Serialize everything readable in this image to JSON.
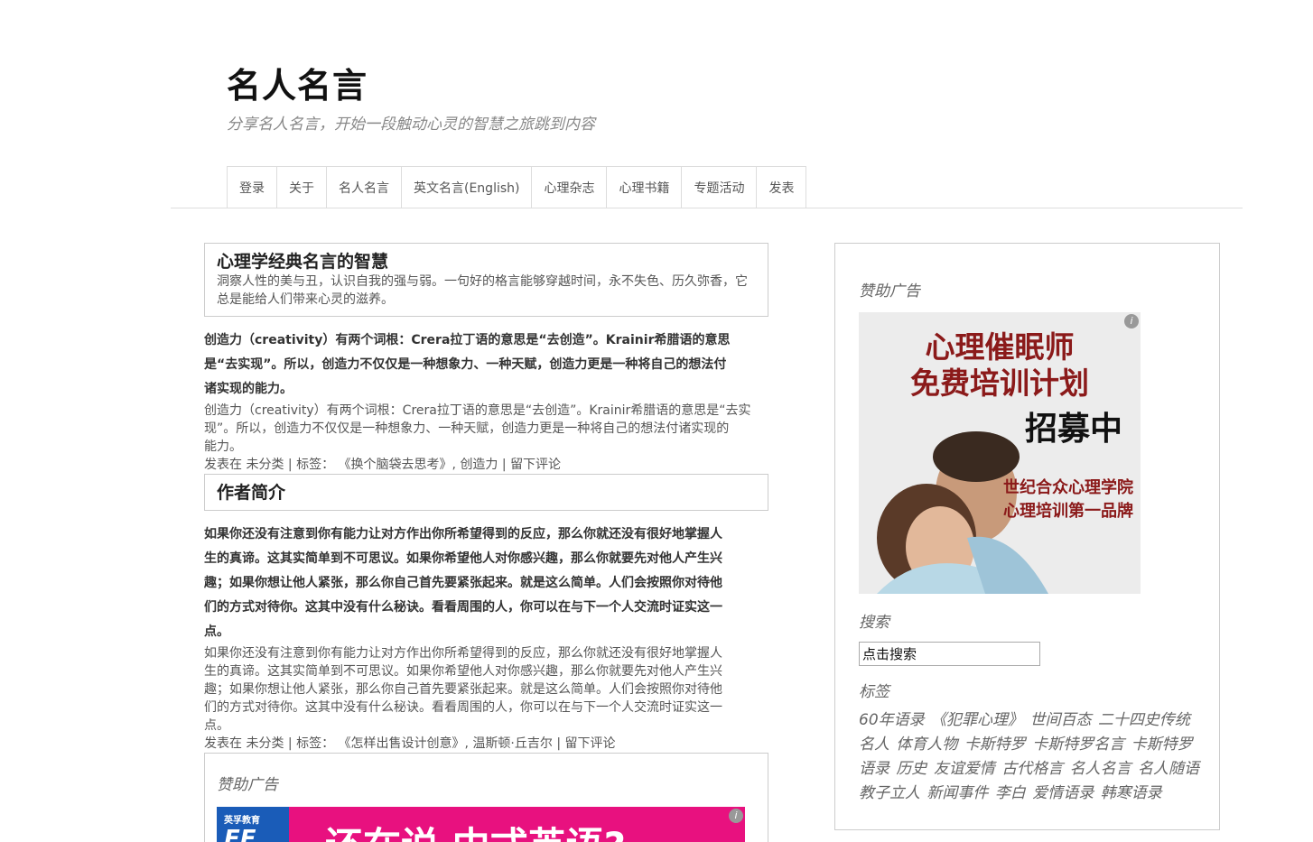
{
  "site": {
    "title": "名人名言",
    "description": "分享名人名言，开始一段触动心灵的智慧之旅跳到内容"
  },
  "nav": {
    "items": [
      "登录",
      "关于",
      "名人名言",
      "英文名言(English)",
      "心理杂志",
      "心理书籍",
      "专题活动",
      "发表"
    ]
  },
  "intro_box": {
    "title": "心理学经典名言的智慧",
    "text": "洞察人性的美与丑，认识自我的强与弱。一句好的格言能够穿越时间，永不失色、历久弥香，它总是能给人们带来心灵的滋养。"
  },
  "post1": {
    "bold_lines": [
      "创造力（creativity）有两个词根：Crera拉丁语的意思是“去创造”。Krainir希腊语的意思",
      "是“去实现”。所以，创造力不仅仅是一种想象力、一种天赋，创造力更是一种将自己的想法付",
      "诸实现的能力。"
    ],
    "text_lines": [
      "创造力（creativity）有两个词根：Crera拉丁语的意思是“去创造”。Krainir希腊语的意思是“去实",
      "现”。所以，创造力不仅仅是一种想象力、一种天赋，创造力更是一种将自己的想法付诸实现的",
      "能力。"
    ],
    "meta": {
      "posted_in": "发表在",
      "category": "未分类",
      "sep1": " | ",
      "tags_label": "标签：",
      "tag1": "《换个脑袋去思考》",
      "tag2": "创造力",
      "sep2": " | ",
      "comment": "留下评论"
    }
  },
  "author_box": {
    "title": "作者简介"
  },
  "post2": {
    "bold_lines": [
      "如果你还没有注意到你有能力让对方作出你所希望得到的反应，那么你就还没有很好地掌握人",
      "生的真谛。这其实简单到不可思议。如果你希望他人对你感兴趣，那么你就要先对他人产生兴",
      "趣；如果你想让他人紧张，那么你自己首先要紧张起来。就是这么简单。人们会按照你对待他",
      "们的方式对待你。这其中没有什么秘诀。看看周围的人，你可以在与下一个人交流时证实这一",
      "点。"
    ],
    "text_lines": [
      "如果你还没有注意到你有能力让对方作出你所希望得到的反应，那么你就还没有很好地掌握人",
      "生的真谛。这其实简单到不可思议。如果你希望他人对你感兴趣，那么你就要先对他人产生兴",
      "趣；如果你想让他人紧张，那么你自己首先要紧张起来。就是这么简单。人们会按照你对待他",
      "们的方式对待你。这其中没有什么秘诀。看看周围的人，你可以在与下一个人交流时证实这一",
      "点。"
    ],
    "meta": {
      "posted_in": "发表在",
      "category": "未分类",
      "sep1": " | ",
      "tags_label": "标签：",
      "tag1": "《怎样出售设计创意》",
      "tag2": "温斯顿·丘吉尔",
      "sep2": " | ",
      "comment": "留下评论"
    }
  },
  "main_ad": {
    "title": "赞助广告",
    "logo_small": "英孚教育",
    "logo_big": "EF",
    "headline": "还在说 中式英语?"
  },
  "sidebar": {
    "ad_title": "赞助广告",
    "ad": {
      "line1": "心理催眠师",
      "line2": "免费培训计划",
      "line3": "招募中",
      "brand1": "世纪合众心理学院",
      "brand2": "心理培训第一品牌"
    },
    "search_title": "搜索",
    "search_value": "点击搜索",
    "tags_title": "标签",
    "tags": [
      "60年语录",
      "《犯罪心理》",
      "世间百态",
      "二十四史传统",
      "名人",
      "体育人物",
      "卡斯特罗",
      "卡斯特罗名言",
      "卡斯特罗",
      "语录",
      "历史",
      "友谊爱情",
      "古代格言",
      "名人名言",
      "名人随语",
      "教子立人",
      "新闻事件",
      "李白",
      "爱情语录",
      "韩寒语录"
    ]
  },
  "colors": {
    "ad_pink": "#e8117f",
    "ef_blue": "#1a5cb8",
    "ad_red": "#8b1a1a"
  }
}
